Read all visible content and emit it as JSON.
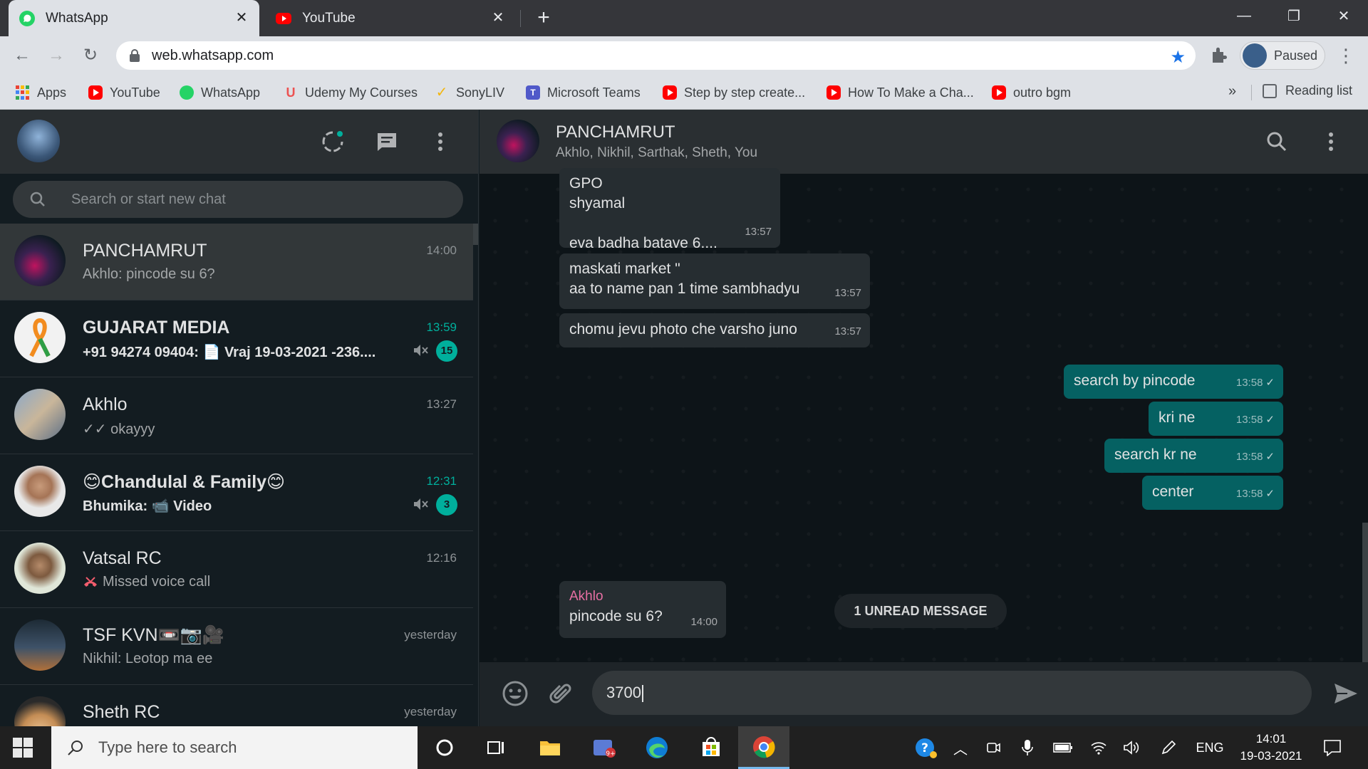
{
  "browser": {
    "tabs": [
      {
        "title": "WhatsApp",
        "active": true
      },
      {
        "title": "YouTube",
        "active": false
      }
    ],
    "new_tab_label": "+",
    "url": "web.whatsapp.com",
    "profile_label": "Paused",
    "bookmarks": [
      {
        "label": "Apps",
        "icon": "apps-grid-icon"
      },
      {
        "label": "YouTube",
        "icon": "youtube-icon"
      },
      {
        "label": "WhatsApp",
        "icon": "whatsapp-icon"
      },
      {
        "label": "Udemy My Courses",
        "icon": "udemy-icon"
      },
      {
        "label": "SonyLIV",
        "icon": "sonyliv-icon"
      },
      {
        "label": "Microsoft Teams",
        "icon": "teams-icon"
      },
      {
        "label": "Step by step create...",
        "icon": "youtube-icon"
      },
      {
        "label": "How To Make a Cha...",
        "icon": "youtube-icon"
      },
      {
        "label": "outro bgm",
        "icon": "youtube-icon"
      }
    ],
    "bookmarks_overflow": "»",
    "reading_list_label": "Reading list"
  },
  "sidebar": {
    "search_placeholder": "Search or start new chat",
    "chats": [
      {
        "name": "PANCHAMRUT",
        "time": "14:00",
        "preview": "Akhlo: pincode su 6?",
        "unread": "",
        "muted": false,
        "bold": false,
        "active": true
      },
      {
        "name": "GUJARAT MEDIA",
        "time": "13:59",
        "preview": "+91 94274 09404: 📄 Vraj    19-03-2021   -236....",
        "unread": "15",
        "muted": true,
        "bold": true,
        "active": false
      },
      {
        "name": "Akhlo",
        "time": "13:27",
        "preview": "✓✓ okayyy",
        "unread": "",
        "muted": false,
        "bold": false,
        "active": false
      },
      {
        "name": "😊Chandulal & Family😊",
        "time": "12:31",
        "preview": "Bhumika: 📹 Video",
        "unread": "3",
        "muted": true,
        "bold": true,
        "active": false
      },
      {
        "name": "Vatsal RC",
        "time": "12:16",
        "preview": "Missed voice call",
        "unread": "",
        "muted": false,
        "bold": false,
        "active": false
      },
      {
        "name": "TSF KVN📼📷🎥",
        "time": "yesterday",
        "preview": "Nikhil: Leotop ma ee",
        "unread": "",
        "muted": false,
        "bold": false,
        "active": false
      },
      {
        "name": "Sheth RC",
        "time": "yesterday",
        "preview": "",
        "unread": "",
        "muted": false,
        "bold": false,
        "active": false
      }
    ]
  },
  "conversation": {
    "title": "PANCHAMRUT",
    "members": "Akhlo, Nikhil, Sarthak, Sheth, You",
    "messages": [
      {
        "dir": "in",
        "lines": [
          "GPO",
          "shyamal",
          "",
          "eva badha batave 6...."
        ],
        "time": "13:57"
      },
      {
        "dir": "in",
        "lines": [
          "maskati market \"",
          "aa to name pan 1 time sambhadyu"
        ],
        "time": "13:57"
      },
      {
        "dir": "in",
        "lines": [
          "chomu jevu photo che varsho juno"
        ],
        "time": "13:57"
      },
      {
        "dir": "out",
        "lines": [
          "search by pincode"
        ],
        "time": "13:58"
      },
      {
        "dir": "out",
        "lines": [
          "kri ne"
        ],
        "time": "13:58"
      },
      {
        "dir": "out",
        "lines": [
          "search kr ne"
        ],
        "time": "13:58"
      },
      {
        "dir": "out",
        "lines": [
          "center"
        ],
        "time": "13:58"
      },
      {
        "dir": "in",
        "sender": "Akhlo",
        "lines": [
          "pincode su 6?"
        ],
        "time": "14:00"
      }
    ],
    "unread_divider": "1 UNREAD MESSAGE",
    "composer_value": "3700"
  },
  "taskbar": {
    "search_placeholder": "Type here to search",
    "language": "ENG",
    "time": "14:01",
    "date": "19-03-2021"
  },
  "colors": {
    "accent": "#00af9c",
    "outgoing_bubble": "#056162",
    "incoming_bubble": "#262d31",
    "sender_name": "#e76fa3"
  }
}
